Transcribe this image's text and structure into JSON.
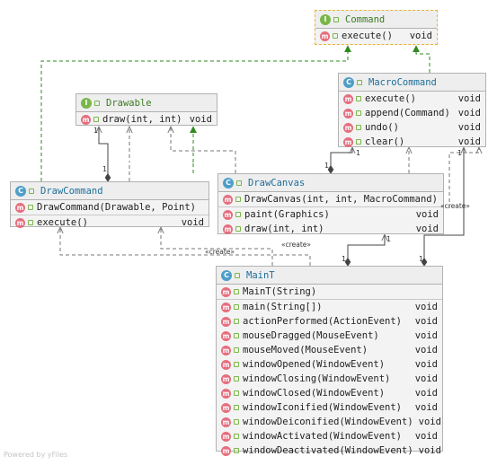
{
  "diagram": {
    "classes": [
      {
        "id": "Command",
        "name": "Command",
        "kind": "interface",
        "selected": true,
        "sections": [
          [
            {
              "sig": "execute()",
              "ret": "void"
            }
          ]
        ]
      },
      {
        "id": "MacroCommand",
        "name": "MacroCommand",
        "kind": "class",
        "sections": [
          [
            {
              "sig": "execute()",
              "ret": "void"
            },
            {
              "sig": "append(Command)",
              "ret": "void"
            },
            {
              "sig": "undo()",
              "ret": "void"
            },
            {
              "sig": "clear()",
              "ret": "void"
            }
          ]
        ]
      },
      {
        "id": "Drawable",
        "name": "Drawable",
        "kind": "interface",
        "sections": [
          [
            {
              "sig": "draw(int, int)",
              "ret": "void"
            }
          ]
        ]
      },
      {
        "id": "DrawCommand",
        "name": "DrawCommand",
        "kind": "class",
        "sections": [
          [
            {
              "sig": "DrawCommand(Drawable, Point)",
              "ret": ""
            }
          ],
          [
            {
              "sig": "execute()",
              "ret": "void"
            }
          ]
        ]
      },
      {
        "id": "DrawCanvas",
        "name": "DrawCanvas",
        "kind": "class",
        "sections": [
          [
            {
              "sig": "DrawCanvas(int, int, MacroCommand)",
              "ret": ""
            }
          ],
          [
            {
              "sig": "paint(Graphics)",
              "ret": "void"
            },
            {
              "sig": "draw(int, int)",
              "ret": "void"
            }
          ]
        ]
      },
      {
        "id": "MainT",
        "name": "MainT",
        "kind": "class",
        "sections": [
          [
            {
              "sig": "MainT(String)",
              "ret": ""
            }
          ],
          [
            {
              "sig": "main(String[])",
              "ret": "void",
              "static": true
            },
            {
              "sig": "actionPerformed(ActionEvent)",
              "ret": "void"
            },
            {
              "sig": "mouseDragged(MouseEvent)",
              "ret": "void"
            },
            {
              "sig": "mouseMoved(MouseEvent)",
              "ret": "void"
            },
            {
              "sig": "windowOpened(WindowEvent)",
              "ret": "void"
            },
            {
              "sig": "windowClosing(WindowEvent)",
              "ret": "void"
            },
            {
              "sig": "windowClosed(WindowEvent)",
              "ret": "void"
            },
            {
              "sig": "windowIconified(WindowEvent)",
              "ret": "void"
            },
            {
              "sig": "windowDeiconified(WindowEvent)",
              "ret": "void"
            },
            {
              "sig": "windowActivated(WindowEvent)",
              "ret": "void"
            },
            {
              "sig": "windowDeactivated(WindowEvent)",
              "ret": "void"
            }
          ]
        ]
      }
    ],
    "relations": [
      {
        "type": "realization",
        "from": "MacroCommand",
        "to": "Command"
      },
      {
        "type": "realization",
        "from": "DrawCommand",
        "to": "Command"
      },
      {
        "type": "realization",
        "from": "DrawCanvas",
        "to": "Drawable"
      },
      {
        "type": "composition",
        "from": "DrawCommand",
        "to": "Drawable",
        "multiplicity": "1"
      },
      {
        "type": "composition",
        "from": "DrawCanvas",
        "to": "MacroCommand",
        "multiplicity": "1"
      },
      {
        "type": "composition",
        "from": "MainT",
        "to": "DrawCanvas",
        "multiplicity": "1"
      },
      {
        "type": "composition",
        "from": "MainT",
        "to": "MacroCommand",
        "multiplicity": "1"
      },
      {
        "type": "dependency",
        "from": "MainT",
        "to": "DrawCommand",
        "label": "«create»"
      },
      {
        "type": "dependency",
        "from": "MainT",
        "to": "DrawCanvas",
        "label": "«create»"
      },
      {
        "type": "dependency",
        "from": "DrawCanvas",
        "to": "DrawCommand"
      },
      {
        "type": "dependency",
        "from": "DrawCommand",
        "to": "Drawable"
      },
      {
        "type": "dependency",
        "from": "DrawCanvas",
        "to": "MacroCommand"
      },
      {
        "type": "dependency",
        "from": "MainT",
        "to": "MacroCommand",
        "label": "«create»"
      }
    ],
    "badges": {
      "class": "C",
      "interface": "I",
      "method": "m"
    },
    "colors": {
      "realization": "#2e8b1c",
      "dependency": "#777777",
      "composition": "#444444",
      "selection": "#e8b230",
      "class_icon": "#4e9ec9",
      "interface_icon": "#7ab648",
      "method_icon": "#e56e7e"
    }
  },
  "watermark": "Powered by yFiles"
}
